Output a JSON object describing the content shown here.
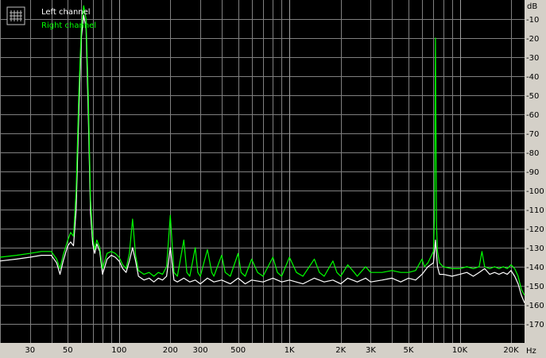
{
  "chart_data": {
    "type": "line",
    "title": "",
    "xlabel": "",
    "ylabel": "",
    "x_unit": "Hz",
    "y_unit": "dB",
    "x_scale": "log",
    "xlim": [
      20,
      24000
    ],
    "ylim": [
      -180,
      0
    ],
    "grid": true,
    "legend_placement": "top-left",
    "x_ticks": [
      {
        "value": 30,
        "label": "30"
      },
      {
        "value": 50,
        "label": "50"
      },
      {
        "value": 100,
        "label": "100"
      },
      {
        "value": 200,
        "label": "200"
      },
      {
        "value": 300,
        "label": "300"
      },
      {
        "value": 500,
        "label": "500"
      },
      {
        "value": 1000,
        "label": "1K"
      },
      {
        "value": 2000,
        "label": "2K"
      },
      {
        "value": 3000,
        "label": "3K"
      },
      {
        "value": 5000,
        "label": "5K"
      },
      {
        "value": 10000,
        "label": "10K"
      },
      {
        "value": 20000,
        "label": "20K"
      }
    ],
    "y_ticks": [
      {
        "value": -10,
        "label": "-10"
      },
      {
        "value": -20,
        "label": "-20"
      },
      {
        "value": -30,
        "label": "-30"
      },
      {
        "value": -40,
        "label": "-40"
      },
      {
        "value": -50,
        "label": "-50"
      },
      {
        "value": -60,
        "label": "-60"
      },
      {
        "value": -70,
        "label": "-70"
      },
      {
        "value": -80,
        "label": "-80"
      },
      {
        "value": -90,
        "label": "-90"
      },
      {
        "value": -100,
        "label": "-100"
      },
      {
        "value": -110,
        "label": "-110"
      },
      {
        "value": -120,
        "label": "-120"
      },
      {
        "value": -130,
        "label": "-130"
      },
      {
        "value": -140,
        "label": "-140"
      },
      {
        "value": -150,
        "label": "-150"
      },
      {
        "value": -160,
        "label": "-160"
      },
      {
        "value": -170,
        "label": "-170"
      }
    ],
    "series": [
      {
        "name": "Left channel",
        "color": "#ffffff",
        "points": [
          [
            20,
            -137
          ],
          [
            25,
            -136
          ],
          [
            30,
            -135
          ],
          [
            35,
            -134
          ],
          [
            40,
            -134
          ],
          [
            43,
            -138
          ],
          [
            45,
            -144
          ],
          [
            47,
            -137
          ],
          [
            50,
            -129
          ],
          [
            52,
            -127
          ],
          [
            54,
            -129
          ],
          [
            56,
            -110
          ],
          [
            58,
            -60
          ],
          [
            60,
            -20
          ],
          [
            62,
            -8
          ],
          [
            64,
            -15
          ],
          [
            66,
            -60
          ],
          [
            68,
            -112
          ],
          [
            70,
            -128
          ],
          [
            72,
            -133
          ],
          [
            74,
            -128
          ],
          [
            77,
            -132
          ],
          [
            80,
            -144
          ],
          [
            85,
            -136
          ],
          [
            90,
            -134
          ],
          [
            95,
            -135
          ],
          [
            100,
            -137
          ],
          [
            105,
            -141
          ],
          [
            110,
            -143
          ],
          [
            115,
            -137
          ],
          [
            120,
            -130
          ],
          [
            125,
            -137
          ],
          [
            130,
            -145
          ],
          [
            140,
            -147
          ],
          [
            150,
            -146
          ],
          [
            160,
            -148
          ],
          [
            170,
            -146
          ],
          [
            180,
            -147
          ],
          [
            190,
            -145
          ],
          [
            200,
            -130
          ],
          [
            210,
            -147
          ],
          [
            220,
            -148
          ],
          [
            240,
            -146
          ],
          [
            260,
            -148
          ],
          [
            280,
            -147
          ],
          [
            300,
            -149
          ],
          [
            330,
            -146
          ],
          [
            360,
            -148
          ],
          [
            400,
            -147
          ],
          [
            450,
            -149
          ],
          [
            500,
            -146
          ],
          [
            550,
            -149
          ],
          [
            600,
            -147
          ],
          [
            700,
            -148
          ],
          [
            800,
            -146
          ],
          [
            900,
            -148
          ],
          [
            1000,
            -147
          ],
          [
            1200,
            -149
          ],
          [
            1400,
            -146
          ],
          [
            1600,
            -148
          ],
          [
            1800,
            -147
          ],
          [
            2000,
            -149
          ],
          [
            2200,
            -146
          ],
          [
            2500,
            -148
          ],
          [
            2800,
            -146
          ],
          [
            3000,
            -148
          ],
          [
            3500,
            -147
          ],
          [
            4000,
            -146
          ],
          [
            4500,
            -148
          ],
          [
            5000,
            -146
          ],
          [
            5500,
            -147
          ],
          [
            6000,
            -144
          ],
          [
            6500,
            -140
          ],
          [
            7000,
            -138
          ],
          [
            7200,
            -126
          ],
          [
            7400,
            -140
          ],
          [
            7600,
            -144
          ],
          [
            8000,
            -144
          ],
          [
            9000,
            -145
          ],
          [
            10000,
            -144
          ],
          [
            11000,
            -143
          ],
          [
            12000,
            -145
          ],
          [
            13000,
            -143
          ],
          [
            14000,
            -141
          ],
          [
            15000,
            -144
          ],
          [
            16000,
            -143
          ],
          [
            17000,
            -144
          ],
          [
            18000,
            -143
          ],
          [
            19000,
            -144
          ],
          [
            20000,
            -142
          ],
          [
            21000,
            -145
          ],
          [
            22000,
            -149
          ],
          [
            23000,
            -155
          ],
          [
            24000,
            -159
          ]
        ]
      },
      {
        "name": "Right channel",
        "color": "#00ff00",
        "points": [
          [
            20,
            -135
          ],
          [
            25,
            -134
          ],
          [
            30,
            -133
          ],
          [
            35,
            -132
          ],
          [
            40,
            -132
          ],
          [
            43,
            -136
          ],
          [
            45,
            -141
          ],
          [
            47,
            -134
          ],
          [
            50,
            -126
          ],
          [
            52,
            -122
          ],
          [
            54,
            -124
          ],
          [
            56,
            -100
          ],
          [
            58,
            -50
          ],
          [
            60,
            -15
          ],
          [
            62,
            -3
          ],
          [
            64,
            -10
          ],
          [
            66,
            -50
          ],
          [
            68,
            -105
          ],
          [
            70,
            -124
          ],
          [
            72,
            -131
          ],
          [
            74,
            -126
          ],
          [
            77,
            -130
          ],
          [
            80,
            -141
          ],
          [
            85,
            -133
          ],
          [
            90,
            -132
          ],
          [
            95,
            -133
          ],
          [
            100,
            -135
          ],
          [
            105,
            -139
          ],
          [
            110,
            -141
          ],
          [
            115,
            -133
          ],
          [
            120,
            -115
          ],
          [
            125,
            -134
          ],
          [
            130,
            -142
          ],
          [
            140,
            -144
          ],
          [
            150,
            -143
          ],
          [
            160,
            -145
          ],
          [
            170,
            -143
          ],
          [
            180,
            -144
          ],
          [
            190,
            -140
          ],
          [
            200,
            -113
          ],
          [
            210,
            -143
          ],
          [
            220,
            -145
          ],
          [
            240,
            -126
          ],
          [
            250,
            -143
          ],
          [
            260,
            -145
          ],
          [
            280,
            -130
          ],
          [
            290,
            -143
          ],
          [
            300,
            -145
          ],
          [
            330,
            -131
          ],
          [
            350,
            -143
          ],
          [
            360,
            -145
          ],
          [
            400,
            -134
          ],
          [
            420,
            -143
          ],
          [
            450,
            -145
          ],
          [
            500,
            -133
          ],
          [
            520,
            -143
          ],
          [
            550,
            -145
          ],
          [
            600,
            -136
          ],
          [
            650,
            -143
          ],
          [
            700,
            -145
          ],
          [
            800,
            -135
          ],
          [
            850,
            -143
          ],
          [
            900,
            -145
          ],
          [
            1000,
            -135
          ],
          [
            1100,
            -143
          ],
          [
            1200,
            -145
          ],
          [
            1400,
            -136
          ],
          [
            1500,
            -143
          ],
          [
            1600,
            -145
          ],
          [
            1800,
            -137
          ],
          [
            1900,
            -143
          ],
          [
            2000,
            -145
          ],
          [
            2200,
            -139
          ],
          [
            2400,
            -143
          ],
          [
            2500,
            -145
          ],
          [
            2800,
            -140
          ],
          [
            3000,
            -143
          ],
          [
            3500,
            -143
          ],
          [
            4000,
            -142
          ],
          [
            4500,
            -143
          ],
          [
            5000,
            -143
          ],
          [
            5500,
            -142
          ],
          [
            6000,
            -136
          ],
          [
            6200,
            -140
          ],
          [
            6500,
            -138
          ],
          [
            7000,
            -132
          ],
          [
            7100,
            -115
          ],
          [
            7200,
            -20
          ],
          [
            7300,
            -118
          ],
          [
            7400,
            -132
          ],
          [
            7600,
            -138
          ],
          [
            8000,
            -140
          ],
          [
            9000,
            -141
          ],
          [
            10000,
            -141
          ],
          [
            11000,
            -140
          ],
          [
            12000,
            -141
          ],
          [
            13000,
            -140
          ],
          [
            13500,
            -132
          ],
          [
            14000,
            -140
          ],
          [
            15000,
            -141
          ],
          [
            16000,
            -140
          ],
          [
            17000,
            -141
          ],
          [
            18000,
            -140
          ],
          [
            19000,
            -141
          ],
          [
            20000,
            -139
          ],
          [
            21000,
            -141
          ],
          [
            22000,
            -145
          ],
          [
            23000,
            -152
          ],
          [
            24000,
            -155
          ]
        ]
      }
    ]
  }
}
